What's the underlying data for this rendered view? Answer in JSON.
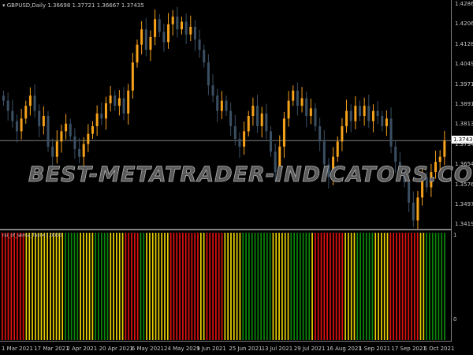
{
  "header": {
    "symbol_label": "GBPUSD,Daily",
    "open": "1.36698",
    "high": "1.37721",
    "low": "1.36667",
    "close": "1.37435"
  },
  "price_axis": {
    "ticks": [
      "1.42860",
      "1.42065",
      "1.41285",
      "1.40490",
      "1.39710",
      "1.38915",
      "1.38135",
      "1.37340",
      "1.36545",
      "1.35765",
      "1.34970",
      "1.34190"
    ],
    "current_price": "1.37435",
    "current_price_value": 1.37435
  },
  "watermark": "BEST-METATRADER-INDICATORS.COM",
  "indicator": {
    "label": "rsi_of_sema_fast=1.0000",
    "scale_max": "1",
    "scale_min": "0",
    "segments": [
      [
        "red",
        8
      ],
      [
        "yellow",
        13
      ],
      [
        "green",
        5
      ],
      [
        "yellow",
        5
      ],
      [
        "green",
        5
      ],
      [
        "yellow",
        5
      ],
      [
        "red",
        5
      ],
      [
        "green",
        2
      ],
      [
        "yellow",
        8
      ],
      [
        "red",
        10
      ],
      [
        "yellow",
        2
      ],
      [
        "red",
        6
      ],
      [
        "yellow",
        6
      ],
      [
        "green",
        10
      ],
      [
        "yellow",
        6
      ],
      [
        "green",
        7
      ],
      [
        "yellow",
        1
      ],
      [
        "red",
        10
      ],
      [
        "yellow",
        4
      ],
      [
        "green",
        6
      ],
      [
        "yellow",
        5
      ],
      [
        "red",
        10
      ],
      [
        "yellow",
        2
      ],
      [
        "green",
        7
      ]
    ]
  },
  "colors": {
    "bull": "#f7a21b",
    "bear": "#3b4f63",
    "red": "#e01010",
    "yellow": "#e8d000",
    "green": "#0a8a0a",
    "grid": "#808080"
  },
  "time_axis": [
    "1 Mar 2021",
    "17 Mar 2021",
    "2 Apr 2021",
    "20 Apr 2021",
    "6 May 2021",
    "24 May 2021",
    "9 Jun 2021",
    "25 Jun 2021",
    "13 Jul 2021",
    "29 Jul 2021",
    "16 Aug 2021",
    "1 Sep 2021",
    "17 Sep 2021",
    "5 Oct 2021"
  ],
  "chart_data": {
    "type": "candlestick",
    "symbol": "GBPUSD",
    "timeframe": "Daily",
    "ylim": [
      1.3419,
      1.4286
    ],
    "closes": [
      1.39,
      1.386,
      1.382,
      1.378,
      1.383,
      1.388,
      1.392,
      1.386,
      1.38,
      1.384,
      1.372,
      1.368,
      1.374,
      1.378,
      1.381,
      1.376,
      1.371,
      1.368,
      1.373,
      1.377,
      1.38,
      1.385,
      1.383,
      1.389,
      1.392,
      1.388,
      1.391,
      1.385,
      1.394,
      1.405,
      1.412,
      1.418,
      1.41,
      1.415,
      1.422,
      1.417,
      1.413,
      1.42,
      1.423,
      1.418,
      1.421,
      1.416,
      1.419,
      1.414,
      1.41,
      1.405,
      1.396,
      1.392,
      1.386,
      1.39,
      1.386,
      1.38,
      1.375,
      1.372,
      1.378,
      1.384,
      1.388,
      1.38,
      1.385,
      1.378,
      1.37,
      1.362,
      1.372,
      1.383,
      1.39,
      1.394,
      1.388,
      1.391,
      1.384,
      1.387,
      1.38,
      1.374,
      1.365,
      1.36,
      1.368,
      1.374,
      1.38,
      1.386,
      1.382,
      1.388,
      1.384,
      1.388,
      1.382,
      1.386,
      1.384,
      1.38,
      1.383,
      1.372,
      1.366,
      1.362,
      1.358,
      1.35,
      1.343,
      1.352,
      1.36,
      1.356,
      1.362,
      1.366,
      1.368,
      1.37435
    ]
  }
}
